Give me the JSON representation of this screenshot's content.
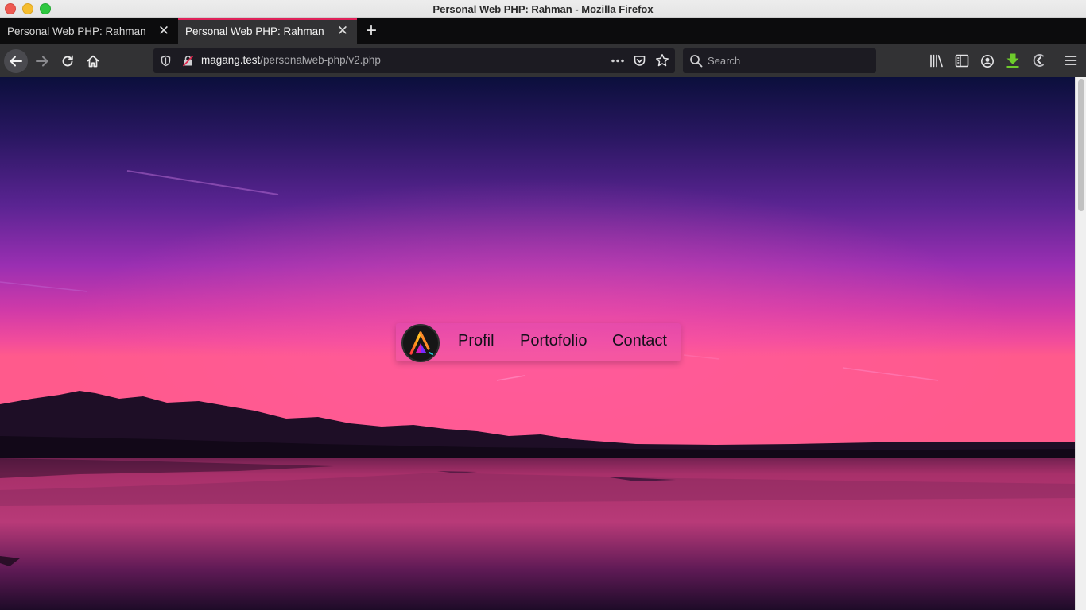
{
  "window": {
    "title": "Personal Web PHP: Rahman - Mozilla Firefox"
  },
  "tabs": [
    {
      "label": "Personal Web PHP: Rahman",
      "active": false
    },
    {
      "label": "Personal Web PHP: Rahman",
      "active": true
    }
  ],
  "navbar": {
    "url_host": "magang.test",
    "url_path": "/personalweb-php/v2.php",
    "search_placeholder": "Search"
  },
  "page": {
    "menu": [
      {
        "label": "Profil"
      },
      {
        "label": "Portofolio"
      },
      {
        "label": "Contact"
      }
    ]
  },
  "colors": {
    "tab_accent": "#e0225a",
    "download_icon": "#6ecb2c"
  }
}
